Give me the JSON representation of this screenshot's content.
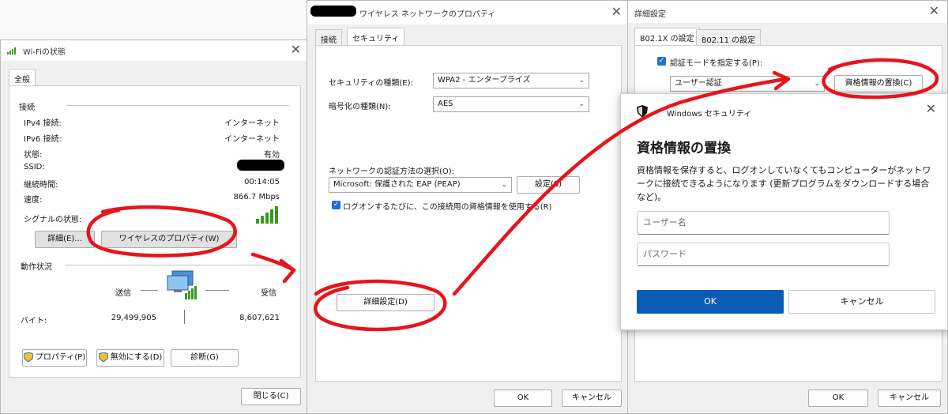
{
  "wifi_status": {
    "title": "Wi-Fiの状態",
    "tab": "全般",
    "connection_header": "接続",
    "rows": [
      {
        "label": "IPv4 接続:",
        "value": "インターネット"
      },
      {
        "label": "IPv6 接続:",
        "value": "インターネット"
      },
      {
        "label": "状態:",
        "value": "有効"
      },
      {
        "label": "SSID:",
        "value": ""
      },
      {
        "label": "継続時間:",
        "value": "00:14:05"
      },
      {
        "label": "速度:",
        "value": "866.7 Mbps"
      }
    ],
    "signal_label": "シグナルの状態:",
    "details_button": "詳細(E)...",
    "wireless_props_button": "ワイヤレスのプロパティ(W)",
    "activity_header": "動作状況",
    "sent_label": "送信",
    "received_label": "受信",
    "bytes_label": "バイト:",
    "bytes_sent": "29,499,905",
    "bytes_received": "8,607,621",
    "properties_button": "プロパティ(P)",
    "disable_button": "無効にする(D)",
    "diagnose_button": "診断(G)",
    "close_button": "閉じる(C)"
  },
  "wireless_props": {
    "title": "ワイヤレス ネットワークのプロパティ",
    "tab_connection": "接続",
    "tab_security": "セキュリティ",
    "security_type_label": "セキュリティの種類(E):",
    "security_type_value": "WPA2 - エンタープライズ",
    "encryption_label": "暗号化の種類(N):",
    "encryption_value": "AES",
    "auth_method_label": "ネットワークの認証方法の選択(O):",
    "auth_method_value": "Microsoft: 保護された EAP (PEAP)",
    "settings_button": "設定(S)",
    "remember_label": "ログオンするたびに、この接続用の資格情報を使用する(R)",
    "advanced_button": "詳細設定(D)",
    "ok_button": "OK",
    "cancel_button": "キャンセル"
  },
  "advanced_settings": {
    "title": "詳細設定",
    "tab_8021x": "802.1X の設定",
    "tab_80211": "802.11 の設定",
    "specify_auth_label": "認証モードを指定する(P):",
    "auth_mode_value": "ユーザー認証",
    "replace_credentials_button": "資格情報の置換(C)",
    "ok_button": "OK",
    "cancel_button": "キャンセル"
  },
  "windows_security": {
    "header": "Windows セキュリティ",
    "title": "資格情報の置換",
    "description": "資格情報を保存すると、ログオンしていなくてもコンピューターがネットワークに接続できるようになります (更新プログラムをダウンロードする場合など)。",
    "username_placeholder": "ユーザー名",
    "password_placeholder": "パスワード",
    "ok_button": "OK",
    "cancel_button": "キャンセル"
  },
  "colors": {
    "annotation_red": "#e8141c",
    "accent_blue": "#0a5db5",
    "signal_green": "#3a9a22"
  }
}
